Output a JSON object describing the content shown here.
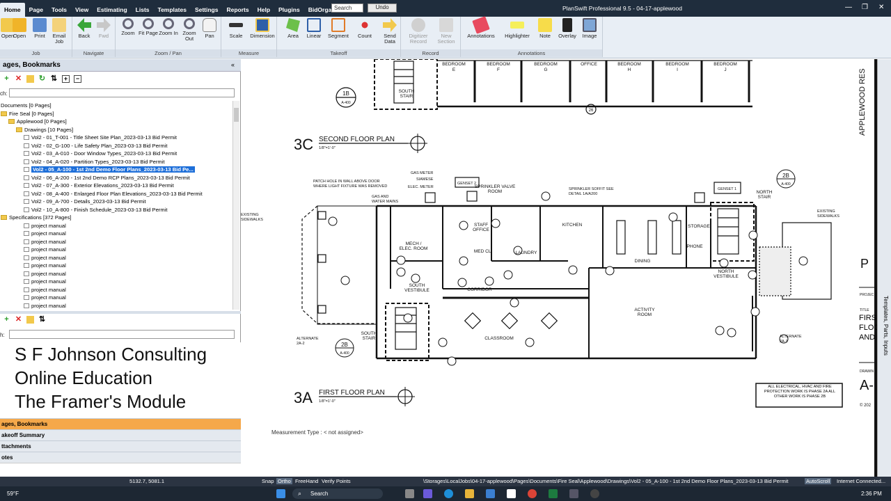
{
  "menu": {
    "items": [
      "Home",
      "Page",
      "Tools",
      "View",
      "Estimating",
      "Lists",
      "Templates",
      "Settings",
      "Reports",
      "Help",
      "Plugins",
      "BidOrganizer"
    ],
    "search_placeholder": "Search",
    "undo_label": "Undo",
    "app_title": "PlanSwift Professional 9.5 - 04-17-applewood"
  },
  "ribbon": {
    "groups": [
      {
        "label": "Job",
        "buttons": [
          {
            "label": "Open"
          },
          {
            "label": "Print"
          },
          {
            "label": "Email Job"
          }
        ]
      },
      {
        "label": "Navigate",
        "buttons": [
          {
            "label": "Back"
          },
          {
            "label": "Fwd"
          }
        ]
      },
      {
        "label": "Zoom / Pan",
        "buttons": [
          {
            "label": "Zoom"
          },
          {
            "label": "Fit Page"
          },
          {
            "label": "Zoom In"
          },
          {
            "label": "Zoom Out"
          },
          {
            "label": "Pan"
          }
        ]
      },
      {
        "label": "Measure",
        "buttons": [
          {
            "label": "Scale"
          },
          {
            "label": "Dimension"
          }
        ]
      },
      {
        "label": "Takeoff",
        "buttons": [
          {
            "label": "Area"
          },
          {
            "label": "Linear"
          },
          {
            "label": "Segment"
          },
          {
            "label": "Count"
          },
          {
            "label": "Send Data"
          }
        ]
      },
      {
        "label": "Record",
        "buttons": [
          {
            "label": "Digitizer Record"
          },
          {
            "label": "New Section"
          }
        ]
      },
      {
        "label": "Annotations",
        "buttons": [
          {
            "label": "Annotations"
          },
          {
            "label": "Highlighter"
          },
          {
            "label": "Note"
          },
          {
            "label": "Overlay"
          },
          {
            "label": "Image"
          }
        ]
      }
    ]
  },
  "left_panel": {
    "title": "ages, Bookmarks",
    "search_label": "ch:",
    "tree": [
      {
        "label": "Documents [0 Pages]",
        "indent": 0,
        "type": "text"
      },
      {
        "label": "Fire Seal [0 Pages]",
        "indent": 0,
        "type": "folder"
      },
      {
        "label": "Applewood [0 Pages]",
        "indent": 1,
        "type": "folder"
      },
      {
        "label": "Drawings [10 Pages]",
        "indent": 2,
        "type": "folder"
      },
      {
        "label": "Vol2 - 01_T-001 - Title Sheet Site Plan_2023-03-13 Bid Permit",
        "indent": 3,
        "type": "page"
      },
      {
        "label": "Vol2 - 02_G-100 - Life Safety Plan_2023-03-13 Bid Permit",
        "indent": 3,
        "type": "page"
      },
      {
        "label": "Vol2 - 03_A-010 - Door Window Types_2023-03-13 Bid Permit",
        "indent": 3,
        "type": "page"
      },
      {
        "label": "Vol2 - 04_A-020 - Partition Types_2023-03-13 Bid Permit",
        "indent": 3,
        "type": "page"
      },
      {
        "label": "Vol2 - 05_A-100 - 1st 2nd Demo Floor Plans_2023-03-13 Bid Pe...",
        "indent": 3,
        "type": "page",
        "selected": true
      },
      {
        "label": "Vol2 - 06_A-200 - 1st 2nd Demo RCP Plans_2023-03-13 Bid Permit",
        "indent": 3,
        "type": "page"
      },
      {
        "label": "Vol2 - 07_A-300 - Exterior Elevations_2023-03-13 Bid Permit",
        "indent": 3,
        "type": "page"
      },
      {
        "label": "Vol2 - 08_A-400 - Enlarged Floor Plan Elevations_2023-03-13 Bid Permit",
        "indent": 3,
        "type": "page"
      },
      {
        "label": "Vol2 - 09_A-700 - Details_2023-03-13 Bid Permit",
        "indent": 3,
        "type": "page"
      },
      {
        "label": "Vol2 - 10_A-800 - Finish Schedule_2023-03-13 Bid Permit",
        "indent": 3,
        "type": "page"
      },
      {
        "label": "Specifications [372 Pages]",
        "indent": 0,
        "type": "folder"
      },
      {
        "label": "project manual",
        "indent": 3,
        "type": "page"
      },
      {
        "label": "project manual",
        "indent": 3,
        "type": "page"
      },
      {
        "label": "project manual",
        "indent": 3,
        "type": "page"
      },
      {
        "label": "project manual",
        "indent": 3,
        "type": "page"
      },
      {
        "label": "project manual",
        "indent": 3,
        "type": "page"
      },
      {
        "label": "project manual",
        "indent": 3,
        "type": "page"
      },
      {
        "label": "project manual",
        "indent": 3,
        "type": "page"
      },
      {
        "label": "project manual",
        "indent": 3,
        "type": "page"
      },
      {
        "label": "project manual",
        "indent": 3,
        "type": "page"
      },
      {
        "label": "project manual",
        "indent": 3,
        "type": "page"
      },
      {
        "label": "project manual",
        "indent": 3,
        "type": "page"
      }
    ],
    "search2_label": "h:",
    "overlay_lines": [
      "S F Johnson Consulting",
      "Online Education",
      "The Framer's Module"
    ],
    "bottom_tabs": [
      {
        "label": "ages, Bookmarks",
        "active": true
      },
      {
        "label": "akeoff Summary",
        "active": false
      },
      {
        "label": "ttachments",
        "active": false
      },
      {
        "label": "otes",
        "active": false
      }
    ]
  },
  "drawing": {
    "plan_top": {
      "number": "3C",
      "title": "SECOND FLOOR PLAN",
      "scale": "1/8\"=1'-0\""
    },
    "plan_bottom": {
      "number": "3A",
      "title": "FIRST FLOOR PLAN",
      "scale": "1/8\"=1'-0\""
    },
    "second_floor_rooms": [
      "BEDROOM E",
      "BEDROOM F",
      "BEDROOM G",
      "OFFICE",
      "BEDROOM H",
      "BEDROOM I",
      "BEDROOM J"
    ],
    "rooms": [
      "STAFF OFFICE",
      "LAUNDRY",
      "KITCHEN",
      "DINING",
      "STORAGE",
      "PHONE",
      "NORTH VESTIBULE",
      "MECH / ELEC. ROOM",
      "SOUTH VESTIBULE",
      "CORRIDOR",
      "MED CL.",
      "CLASSROOM",
      "ACTIVITY ROOM",
      "SOUTH STAIR",
      "NORTH STAIR",
      "SPRINKLER VALVE ROOM"
    ],
    "notes": [
      "PATCH HOLE IN WALL ABOVE DOOR WHERE LIGHT FIXTURE WAS REMOVED",
      "GAS AND WATER MAINS",
      "GAS METER",
      "SIAMESE",
      "ELEC. METER",
      "GENSET 2",
      "GENSET 1",
      "SPRINKLER SOFFIT SEE DETAIL 1A/A200",
      "EXISTING SIDEWALKS",
      "EXISTING SIDEWALKS",
      "ALTERNATE 2A-2",
      "ALTERNATE 2A-1"
    ],
    "general_note": "ALL ELECTRICAL, HVAC AND FIRE PROTECTION WORK IS PHASE 2A ALL OTHER WORK IS PHASE 2B",
    "title_block": {
      "project": "APPLEWOOD RES",
      "title_label": "TITLE",
      "title": "FIRS FLOO AND",
      "drawing_label": "DRAWIN",
      "sheet": "A-",
      "copyright": "© 202"
    },
    "measurement_type": "Measurement Type : < not assigned>"
  },
  "right_strip_label": "Templates, Parts, Inputs",
  "status": {
    "coords": "5132.7, 5081.1",
    "toggles": [
      "Snap",
      "Ortho",
      "FreeHand",
      "Verify Points"
    ],
    "path": "\\Storages\\LocalJobs\\04-17-applewood\\Pages\\Documents\\Fire Seal\\Applewood\\Drawings\\Vol2 - 05_A-100 - 1st 2nd Demo Floor Plans_2023-03-13 Bid Permit",
    "autoscroll": "AutoScroll",
    "connection": "Internet Connected..."
  },
  "taskbar": {
    "weather": "59°F",
    "search": "Search",
    "time": "2:36 PM"
  }
}
